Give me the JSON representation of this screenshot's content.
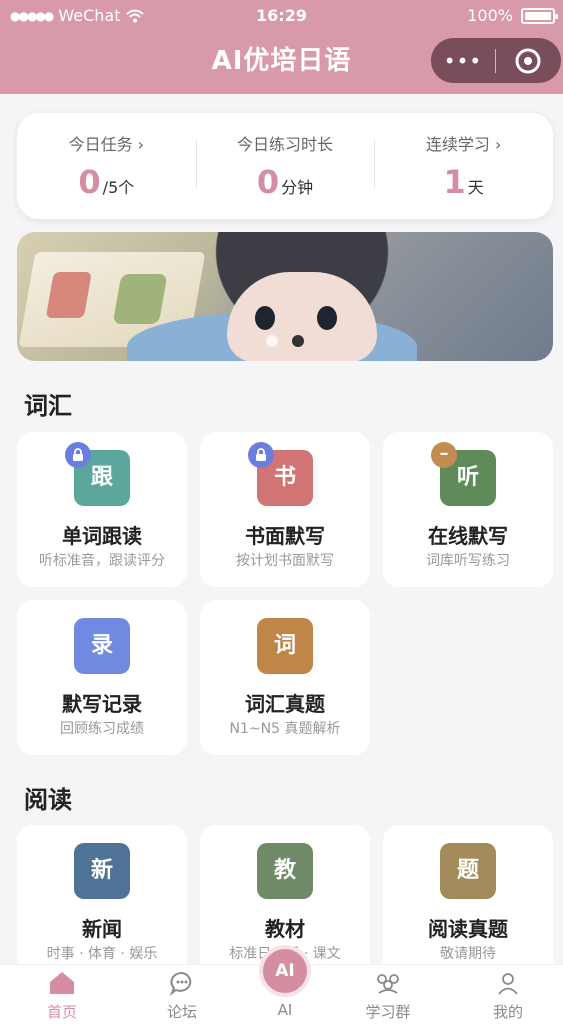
{
  "statusbar": {
    "signal": "●●●●●",
    "carrier": "WeChat",
    "time": "16:29",
    "battery": "100%"
  },
  "nav": {
    "title": "AI优培日语",
    "more_icon": "•••"
  },
  "stats": [
    {
      "label": "今日任务 ›",
      "value": "0",
      "unit": "/5个"
    },
    {
      "label": "今日练习时长",
      "value": "0",
      "unit": "分钟"
    },
    {
      "label": "连续学习 ›",
      "value": "1",
      "unit": "天"
    }
  ],
  "banner": {
    "slides": 2,
    "active_index": 1
  },
  "vocab": {
    "title": "词汇",
    "cards": [
      {
        "icon": "跟",
        "title": "单词跟读",
        "sub": "听标准音，跟读评分",
        "color": "#5ca79c",
        "badge": "lock"
      },
      {
        "icon": "书",
        "title": "书面默写",
        "sub": "按计划书面默写",
        "color": "#d27474",
        "badge": "lock"
      },
      {
        "icon": "听",
        "title": "在线默写",
        "sub": "词库听写练习",
        "color": "#5f8a5a",
        "badge": "minus"
      },
      {
        "icon": "录",
        "title": "默写记录",
        "sub": "回顾练习成绩",
        "color": "#6f8ae0",
        "badge": ""
      },
      {
        "icon": "词",
        "title": "词汇真题",
        "sub": "N1~N5 真题解析",
        "color": "#bf8647",
        "badge": ""
      }
    ]
  },
  "reading": {
    "title": "阅读",
    "cards": [
      {
        "icon": "新",
        "title": "新闻",
        "sub": "时事 · 体育 · 娱乐",
        "color": "#4f7396"
      },
      {
        "icon": "教",
        "title": "教材",
        "sub": "标准日本语 · 课文",
        "color": "#6f8a66"
      },
      {
        "icon": "题",
        "title": "阅读真题",
        "sub": "敬请期待",
        "color": "#a38a5a"
      }
    ]
  },
  "tabbar": {
    "items": [
      {
        "label": "首页",
        "icon": "home-icon",
        "active": true
      },
      {
        "label": "论坛",
        "icon": "chat-icon",
        "active": false
      },
      {
        "label": "AI",
        "icon": "ai-icon",
        "active": false
      },
      {
        "label": "学习群",
        "icon": "group-icon",
        "active": false
      },
      {
        "label": "我的",
        "icon": "user-icon",
        "active": false
      }
    ],
    "accent": "#d58ea1"
  }
}
